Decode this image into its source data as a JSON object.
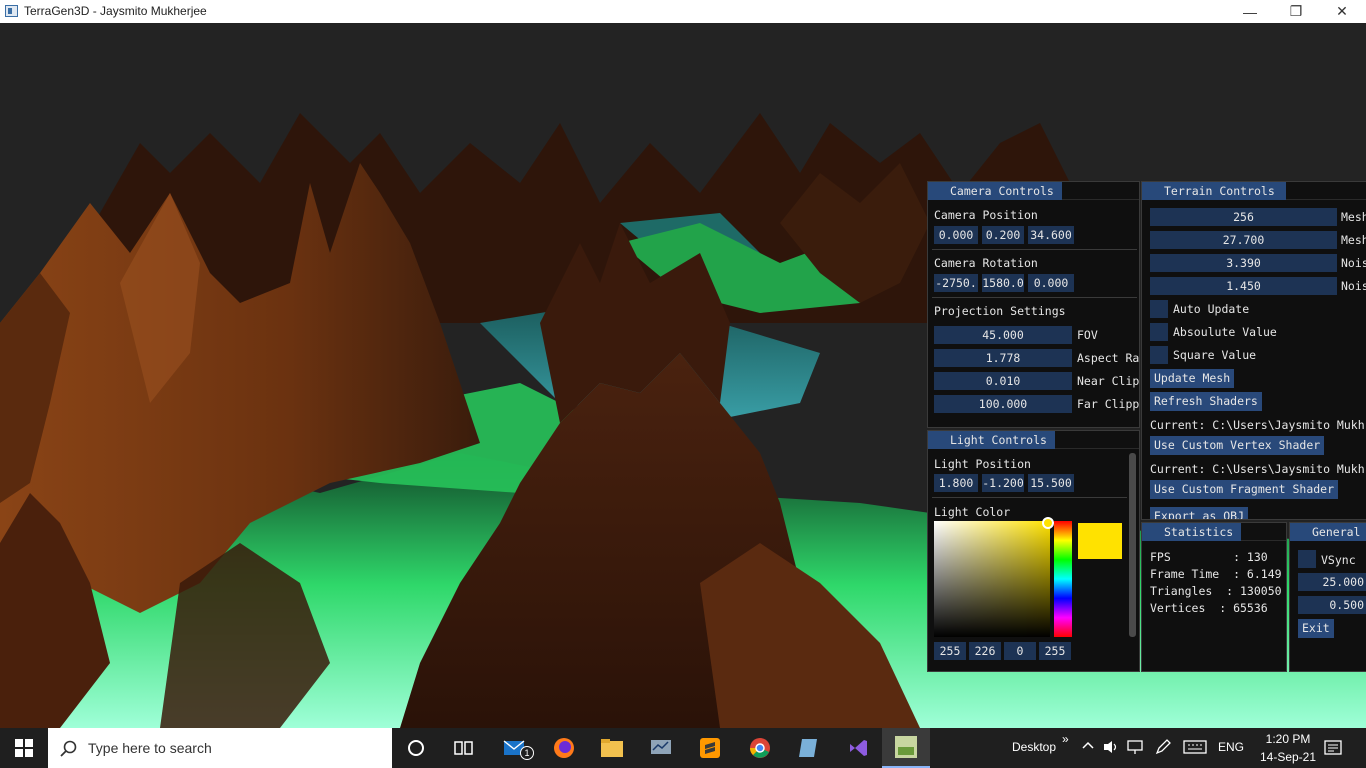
{
  "window": {
    "title": "TerraGen3D - Jaysmito Mukherjee",
    "min": "—",
    "restore": "❐",
    "close": "✕"
  },
  "camera": {
    "tab": "Camera Controls",
    "position_label": "Camera Position",
    "position": [
      "0.000",
      "0.200",
      "34.600"
    ],
    "rotation_label": "Camera Rotation",
    "rotation": [
      "-2750.",
      "1580.0",
      "0.000"
    ],
    "projection_label": "Projection Settings",
    "fov": {
      "value": "45.000",
      "label": "FOV"
    },
    "aspect": {
      "value": "1.778",
      "label": "Aspect Ra"
    },
    "near": {
      "value": "0.010",
      "label": "Near Clip"
    },
    "far": {
      "value": "100.000",
      "label": "Far Clipp"
    }
  },
  "light": {
    "tab": "Light Controls",
    "position_label": "Light Position",
    "position": [
      "1.800",
      "-1.200",
      "15.500"
    ],
    "color_label": "Light Color",
    "color_hex": "#FFE200",
    "rgba": [
      "255",
      "226",
      "0",
      "255"
    ]
  },
  "terrain": {
    "tab": "Terrain Controls",
    "fields": [
      {
        "value": "256",
        "label": "Mesh"
      },
      {
        "value": "27.700",
        "label": "Mesh"
      },
      {
        "value": "3.390",
        "label": "Nois"
      },
      {
        "value": "1.450",
        "label": "Nois"
      }
    ],
    "checks": [
      "Auto Update",
      "Absoulute Value",
      "Square Value"
    ],
    "update_mesh": "Update Mesh",
    "refresh_shaders": "Refresh Shaders",
    "current_vertex": "Current: C:\\Users\\Jaysmito Mukh",
    "use_vertex": "Use Custom Vertex Shader",
    "current_fragment": "Current: C:\\Users\\Jaysmito Mukh",
    "use_fragment": "Use Custom Fragment Shader",
    "export": "Export as OBJ"
  },
  "stats": {
    "tab": "Statistics",
    "lines": [
      "FPS         : 130",
      "Frame Time  : 6.149",
      "Triangles  : 130050",
      "Vertices  : 65536"
    ]
  },
  "general": {
    "tab": "General",
    "vsync": "VSync",
    "v1": "25.000",
    "v2": "0.500",
    "exit": "Exit"
  },
  "taskbar": {
    "search_placeholder": "Type here to search",
    "mail_badge": "1",
    "desktop": "Desktop",
    "chevron": "»",
    "lang": "ENG",
    "time": "1:20 PM",
    "date": "14-Sep-21"
  },
  "colors": {
    "panel_bg": "#0f0f0f",
    "tab_bg": "#28497a",
    "field_bg": "#1d3354",
    "terrain_brown": "#7a3a14",
    "terrain_green": "#3cff7a"
  }
}
